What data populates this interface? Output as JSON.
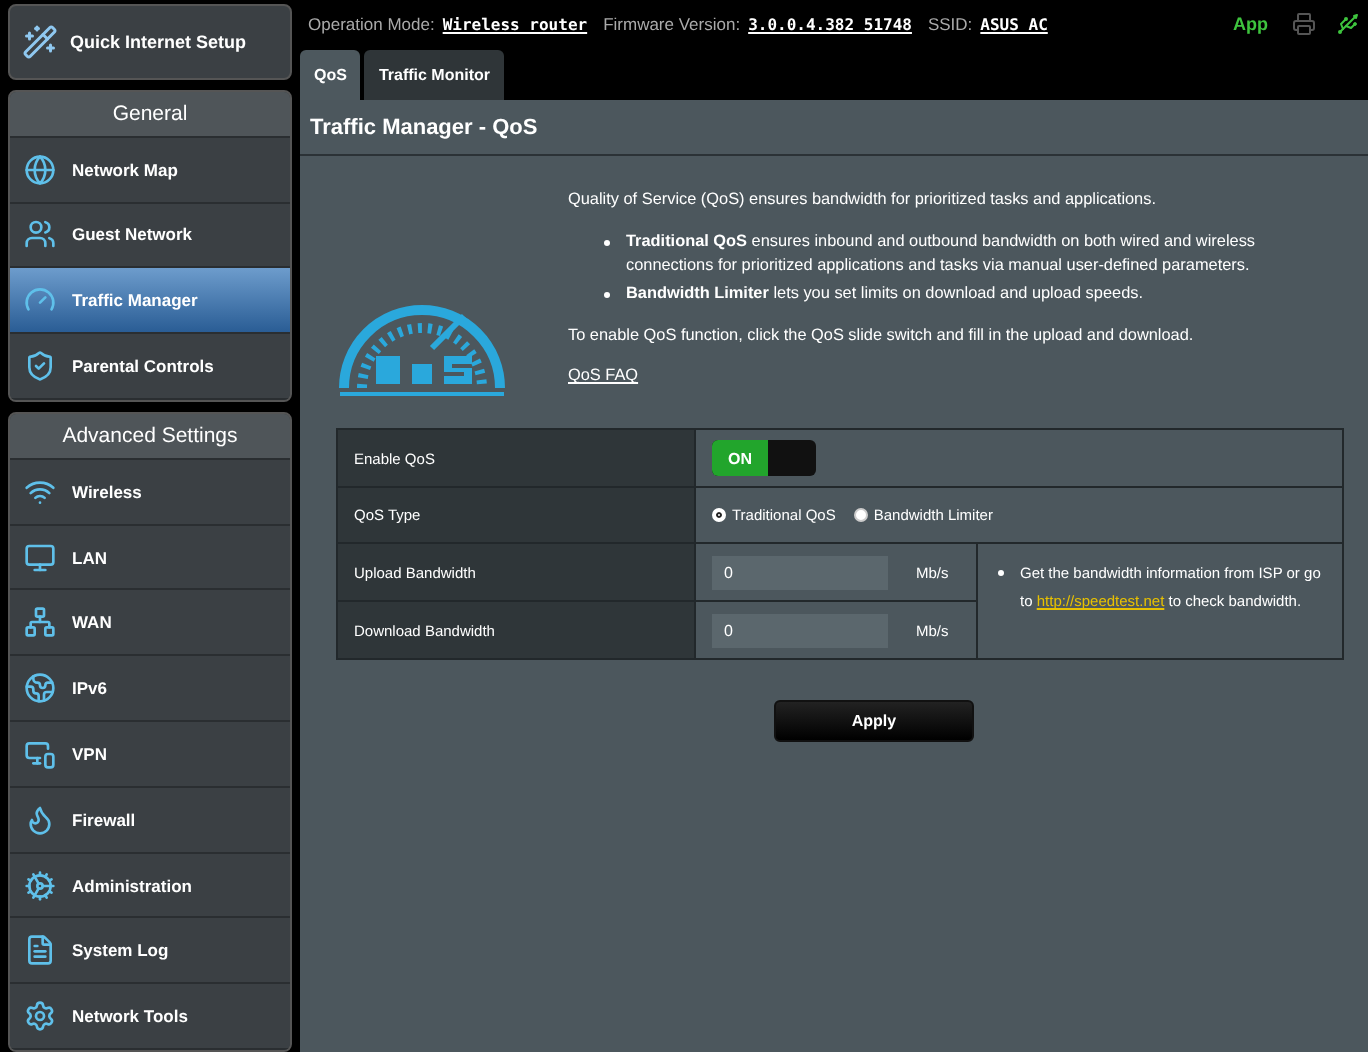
{
  "sidebar": {
    "quick_setup": "Quick Internet Setup",
    "sections": [
      {
        "title": "General",
        "items": [
          {
            "label": "Network Map",
            "selected": false
          },
          {
            "label": "Guest Network",
            "selected": false
          },
          {
            "label": "Traffic Manager",
            "selected": true
          },
          {
            "label": "Parental Controls",
            "selected": false
          }
        ]
      },
      {
        "title": "Advanced Settings",
        "items": [
          {
            "label": "Wireless",
            "selected": false
          },
          {
            "label": "LAN",
            "selected": false
          },
          {
            "label": "WAN",
            "selected": false
          },
          {
            "label": "IPv6",
            "selected": false
          },
          {
            "label": "VPN",
            "selected": false
          },
          {
            "label": "Firewall",
            "selected": false
          },
          {
            "label": "Administration",
            "selected": false
          },
          {
            "label": "System Log",
            "selected": false
          },
          {
            "label": "Network Tools",
            "selected": false
          }
        ]
      }
    ]
  },
  "top_bar": {
    "operation_mode_label": "Operation Mode:",
    "operation_mode": "Wireless router",
    "firmware_label": "Firmware Version:",
    "firmware": "3.0.0.4.382_51748",
    "ssid_label": "SSID:",
    "ssid": "ASUS_AC",
    "app": "App"
  },
  "tabs": [
    {
      "label": "QoS",
      "selected": true
    },
    {
      "label": "Traffic Monitor",
      "selected": false
    }
  ],
  "page_title": "Traffic Manager - QoS",
  "intro": "Quality of Service (QoS) ensures bandwidth for prioritized tasks and applications.",
  "bullets": [
    "**Traditional QoS** ensures inbound and outbound bandwidth on both wired and wireless connections for prioritized applications and tasks via manual user-defined parameters.",
    "**Bandwidth Limiter** lets you set limits on download and upload speeds."
  ],
  "instruction": "To enable QoS function, click the QoS slide switch and fill in the upload and download.",
  "faq_link": "QoS FAQ",
  "form": {
    "enable": {
      "label": "Enable QoS",
      "on": true,
      "on_text": "ON"
    },
    "type": {
      "label": "QoS Type",
      "options": [
        {
          "label": "Traditional QoS",
          "selected": true
        },
        {
          "label": "Bandwidth Limiter",
          "selected": false
        }
      ]
    },
    "bandwidth": [
      {
        "label": "Upload Bandwidth",
        "value": "0",
        "unit": "Mb/s"
      },
      {
        "label": "Download Bandwidth",
        "value": "0",
        "unit": "Mb/s"
      }
    ],
    "note": {
      "before": "Get the bandwidth information from ISP or go to",
      "link": "http://speedtest.net",
      "after": "to check bandwidth."
    }
  },
  "apply": "Apply"
}
